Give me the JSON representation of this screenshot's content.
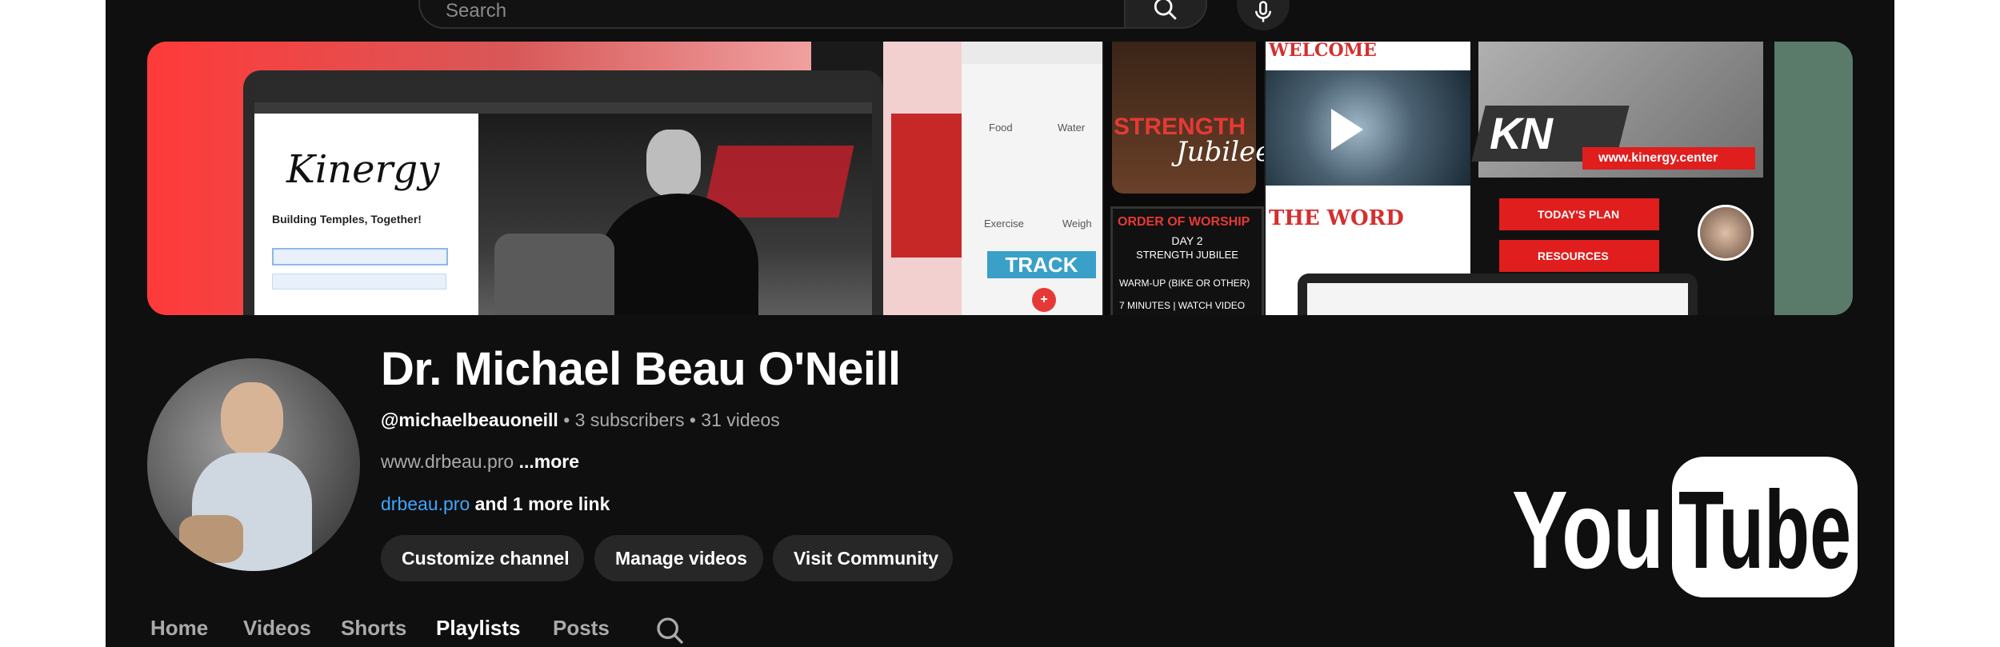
{
  "search": {
    "placeholder": "Search"
  },
  "channel": {
    "name": "Dr. Michael Beau O'Neill",
    "handle": "@michaelbeauoneill",
    "subscribers": "3 subscribers",
    "videos": "31 videos",
    "separator": " • ",
    "description": "www.drbeau.pro",
    "more_label": "...more",
    "link": "drbeau.pro",
    "link_suffix": " and 1 more link"
  },
  "actions": {
    "customize_label": "Customize channel",
    "manage_label": "Manage videos",
    "community_label": "Visit Community"
  },
  "tabs": [
    {
      "label": "Home",
      "active": false
    },
    {
      "label": "Videos",
      "active": false
    },
    {
      "label": "Shorts",
      "active": false
    },
    {
      "label": "Playlists",
      "active": true
    },
    {
      "label": "Posts",
      "active": false
    }
  ],
  "logo": {
    "text_left": "You",
    "text_right": "Tube"
  },
  "banner": {
    "kinergy_title": "Kinergy",
    "kinergy_tagline": "Building Temples, Together!",
    "strength": "STRENGTH",
    "jubilee": "Jubilee",
    "track": "TRACK",
    "food_label": "Food",
    "water_label": "Water",
    "exercise_label": "Exercise",
    "weight_label": "Weigh",
    "worship_title": "ORDER OF WORSHIP",
    "worship_day": "DAY 2",
    "worship_sub": "STRENGTH JUBILEE",
    "worship_item1": "WARM-UP (BIKE OR OTHER)",
    "worship_item2": "7 MINUTES | WATCH VIDEO",
    "welcome": "WELCOME",
    "the_word": "THE WORD",
    "kn_logo": "KN",
    "kn_url": "www.kinergy.center",
    "todays_plan": "TODAY'S PLAN",
    "resources": "RESOURCES"
  },
  "colors": {
    "background": "#0f0f0f",
    "accent_link": "#3ea6ff",
    "button": "#272727",
    "brand_red": "#ff0000"
  }
}
